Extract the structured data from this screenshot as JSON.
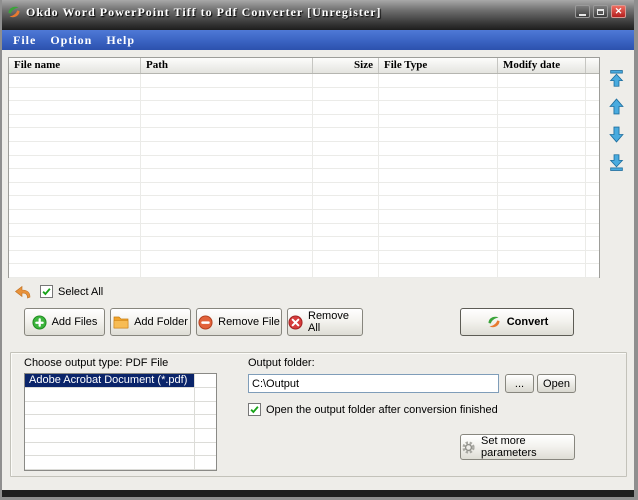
{
  "window": {
    "title": "Okdo Word PowerPoint Tiff to Pdf Converter [Unregister]",
    "controls": {
      "minimize": "minimize",
      "maximize": "maximize",
      "close_glyph": "✕"
    }
  },
  "menu": {
    "items": [
      {
        "label": "File"
      },
      {
        "label": "Option"
      },
      {
        "label": "Help"
      }
    ]
  },
  "file_list": {
    "columns": [
      {
        "label": "File name",
        "align": "left"
      },
      {
        "label": "Path",
        "align": "left"
      },
      {
        "label": "Size",
        "align": "right"
      },
      {
        "label": "File Type",
        "align": "left"
      },
      {
        "label": "Modify date",
        "align": "left"
      },
      {
        "label": "",
        "align": "left"
      }
    ],
    "rows": [],
    "empty_row_count": 15
  },
  "reorder": {
    "buttons": [
      "move-to-top",
      "move-up",
      "move-down",
      "move-to-bottom"
    ]
  },
  "select_all": {
    "label": "Select All",
    "checked": true
  },
  "actions": {
    "add_files": "Add Files",
    "add_folder": "Add Folder",
    "remove_file": "Remove File",
    "remove_all": "Remove All",
    "convert": "Convert"
  },
  "output_section": {
    "choose_type_label": "Choose output type:  PDF File",
    "format_list": {
      "items": [
        "Adobe Acrobat Document (*.pdf)"
      ],
      "selected_index": 0,
      "visible_row_count": 7
    },
    "folder_label": "Output folder:",
    "folder_path": "C:\\Output",
    "browse_button": "...",
    "open_button": "Open",
    "open_after_finish": {
      "label": "Open the output folder after conversion finished",
      "checked": true
    },
    "set_more_parameters": "Set more parameters"
  },
  "colors": {
    "menu_bar": "#3a63c2",
    "selection": "#0a246a",
    "arrow_blue": "#3ba0d8",
    "accent_orange": "#e8923a",
    "close_red": "#cf3a3a",
    "check_green": "#17a317"
  }
}
